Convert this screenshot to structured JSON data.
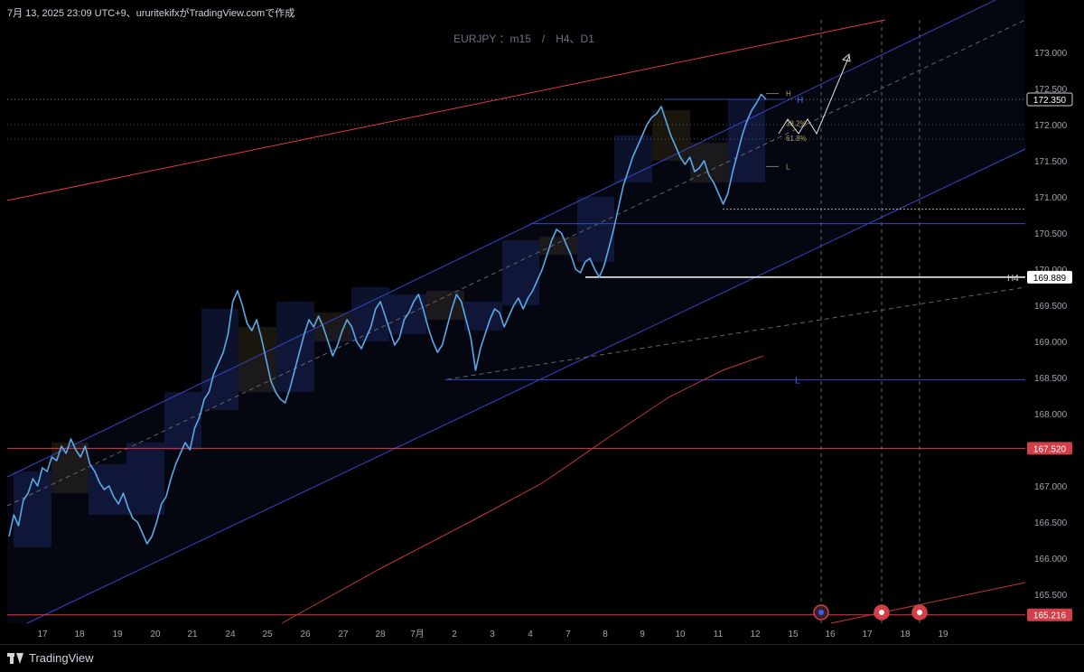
{
  "header": {
    "caption": "7月 13, 2025 23:09 UTC+9、ururitekifxがTradingView.comで作成"
  },
  "brand": {
    "name": "TradingView"
  },
  "colors": {
    "background": "#000000",
    "candle": "#5aa9e6",
    "channel": "#3446c8",
    "red_line": "#e23a3a",
    "ma_line": "#c0392b",
    "h4_label_bg": "#ffffff",
    "red_label_bg": "#d23f48"
  },
  "chart_data": {
    "type": "line",
    "symbol_label": "EURJPY ：m15　/　H4、D1",
    "y_ticks": [
      {
        "value": 173.0,
        "label": "173.000"
      },
      {
        "value": 172.5,
        "label": "172.500"
      },
      {
        "value": 172.0,
        "label": "172.000"
      },
      {
        "value": 171.5,
        "label": "171.500"
      },
      {
        "value": 171.0,
        "label": "171.000"
      },
      {
        "value": 170.5,
        "label": "170.500"
      },
      {
        "value": 170.0,
        "label": "170.000"
      },
      {
        "value": 169.5,
        "label": "169.500"
      },
      {
        "value": 169.0,
        "label": "169.000"
      },
      {
        "value": 168.5,
        "label": "168.500"
      },
      {
        "value": 168.0,
        "label": "168.000"
      },
      {
        "value": 167.0,
        "label": "167.000"
      },
      {
        "value": 166.5,
        "label": "166.500"
      },
      {
        "value": 166.0,
        "label": "166.000"
      },
      {
        "value": 165.5,
        "label": "165.500"
      }
    ],
    "x_ticks": [
      "17",
      "18",
      "19",
      "20",
      "21",
      "24",
      "25",
      "26",
      "27",
      "28",
      "7月",
      "2",
      "3",
      "4",
      "7",
      "8",
      "9",
      "10",
      "11",
      "12",
      "15",
      "16",
      "17",
      "18",
      "19"
    ],
    "ylim": [
      165.1,
      173.45
    ],
    "price_markers": [
      {
        "value": 172.35,
        "label": "172.350",
        "style": "price"
      },
      {
        "value": 169.889,
        "label": "169.889",
        "style": "white",
        "tag": "H4"
      },
      {
        "value": 167.52,
        "label": "167.520",
        "style": "red"
      },
      {
        "value": 165.216,
        "label": "165.216",
        "style": "red"
      }
    ],
    "horizontal_levels": [
      {
        "value": 172.35,
        "label": "H",
        "color": "#4a70f0"
      },
      {
        "value": 170.63,
        "label": "",
        "color": "#4a70f0"
      },
      {
        "value": 168.47,
        "label": "L",
        "color": "#4a70f0"
      },
      {
        "value": 170.83,
        "label": "",
        "color": "#aaaaaa"
      }
    ],
    "fib_labels": [
      {
        "value": 172.02,
        "label": "38.2%"
      },
      {
        "value": 171.81,
        "label": "61.8%"
      },
      {
        "value": 172.43,
        "label": "H"
      },
      {
        "value": 171.42,
        "label": "L"
      }
    ],
    "price_series": [
      166.3,
      166.6,
      166.45,
      166.8,
      166.9,
      167.1,
      167.0,
      167.25,
      167.2,
      167.4,
      167.35,
      167.55,
      167.45,
      167.65,
      167.5,
      167.4,
      167.55,
      167.3,
      167.2,
      167.05,
      166.95,
      167.0,
      166.85,
      166.75,
      166.9,
      166.7,
      166.55,
      166.5,
      166.35,
      166.2,
      166.3,
      166.5,
      166.75,
      166.85,
      167.1,
      167.3,
      167.45,
      167.6,
      167.5,
      167.8,
      167.95,
      168.2,
      168.3,
      168.55,
      168.7,
      168.85,
      169.1,
      169.55,
      169.7,
      169.5,
      169.25,
      169.15,
      169.3,
      169.05,
      168.75,
      168.45,
      168.3,
      168.2,
      168.15,
      168.35,
      168.6,
      168.85,
      169.1,
      169.3,
      169.2,
      169.35,
      169.2,
      169.0,
      168.8,
      168.95,
      169.15,
      169.3,
      169.2,
      169.0,
      168.9,
      169.05,
      169.2,
      169.45,
      169.55,
      169.35,
      169.15,
      168.95,
      169.05,
      169.3,
      169.4,
      169.55,
      169.65,
      169.45,
      169.2,
      169.0,
      168.85,
      168.95,
      169.2,
      169.45,
      169.65,
      169.55,
      169.3,
      169.05,
      168.6,
      168.9,
      169.1,
      169.3,
      169.45,
      169.4,
      169.2,
      169.35,
      169.5,
      169.6,
      169.45,
      169.6,
      169.7,
      169.85,
      170.0,
      170.2,
      170.4,
      170.55,
      170.5,
      170.35,
      170.2,
      170.0,
      169.95,
      170.1,
      170.15,
      170.0,
      169.89,
      170.05,
      170.3,
      170.55,
      170.85,
      171.15,
      171.35,
      171.55,
      171.7,
      171.85,
      172.0,
      172.1,
      172.15,
      172.25,
      172.05,
      171.85,
      171.7,
      171.55,
      171.45,
      171.55,
      171.35,
      171.4,
      171.5,
      171.3,
      171.2,
      171.05,
      170.9,
      171.05,
      171.35,
      171.6,
      171.85,
      172.05,
      172.2,
      172.3,
      172.42,
      172.35
    ]
  }
}
